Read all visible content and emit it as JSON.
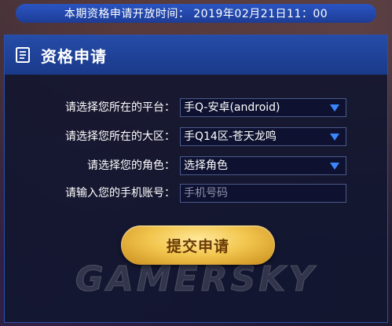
{
  "banner": {
    "text": "本期资格申请开放时间： 2019年02月21日11：00"
  },
  "panel": {
    "title": "资格申请",
    "icon": "document-icon"
  },
  "form": {
    "platform": {
      "label": "请选择您所在的平台：",
      "value": "手Q-安卓(android)"
    },
    "region": {
      "label": "请选择您所在的大区：",
      "value": "手Q14区-苍天龙鸣"
    },
    "role": {
      "label": "请选择您的角色：",
      "value": "选择角色"
    },
    "phone": {
      "label": "请输入您的手机账号：",
      "placeholder": "手机号码",
      "value": ""
    },
    "submit_label": "提交申请"
  },
  "watermark": "GAMERSKY",
  "colors": {
    "accent_blue": "#254ca8",
    "arrow_blue": "#3a86ff",
    "button_gold": "#f2c64e",
    "button_text": "#6a3a06"
  }
}
